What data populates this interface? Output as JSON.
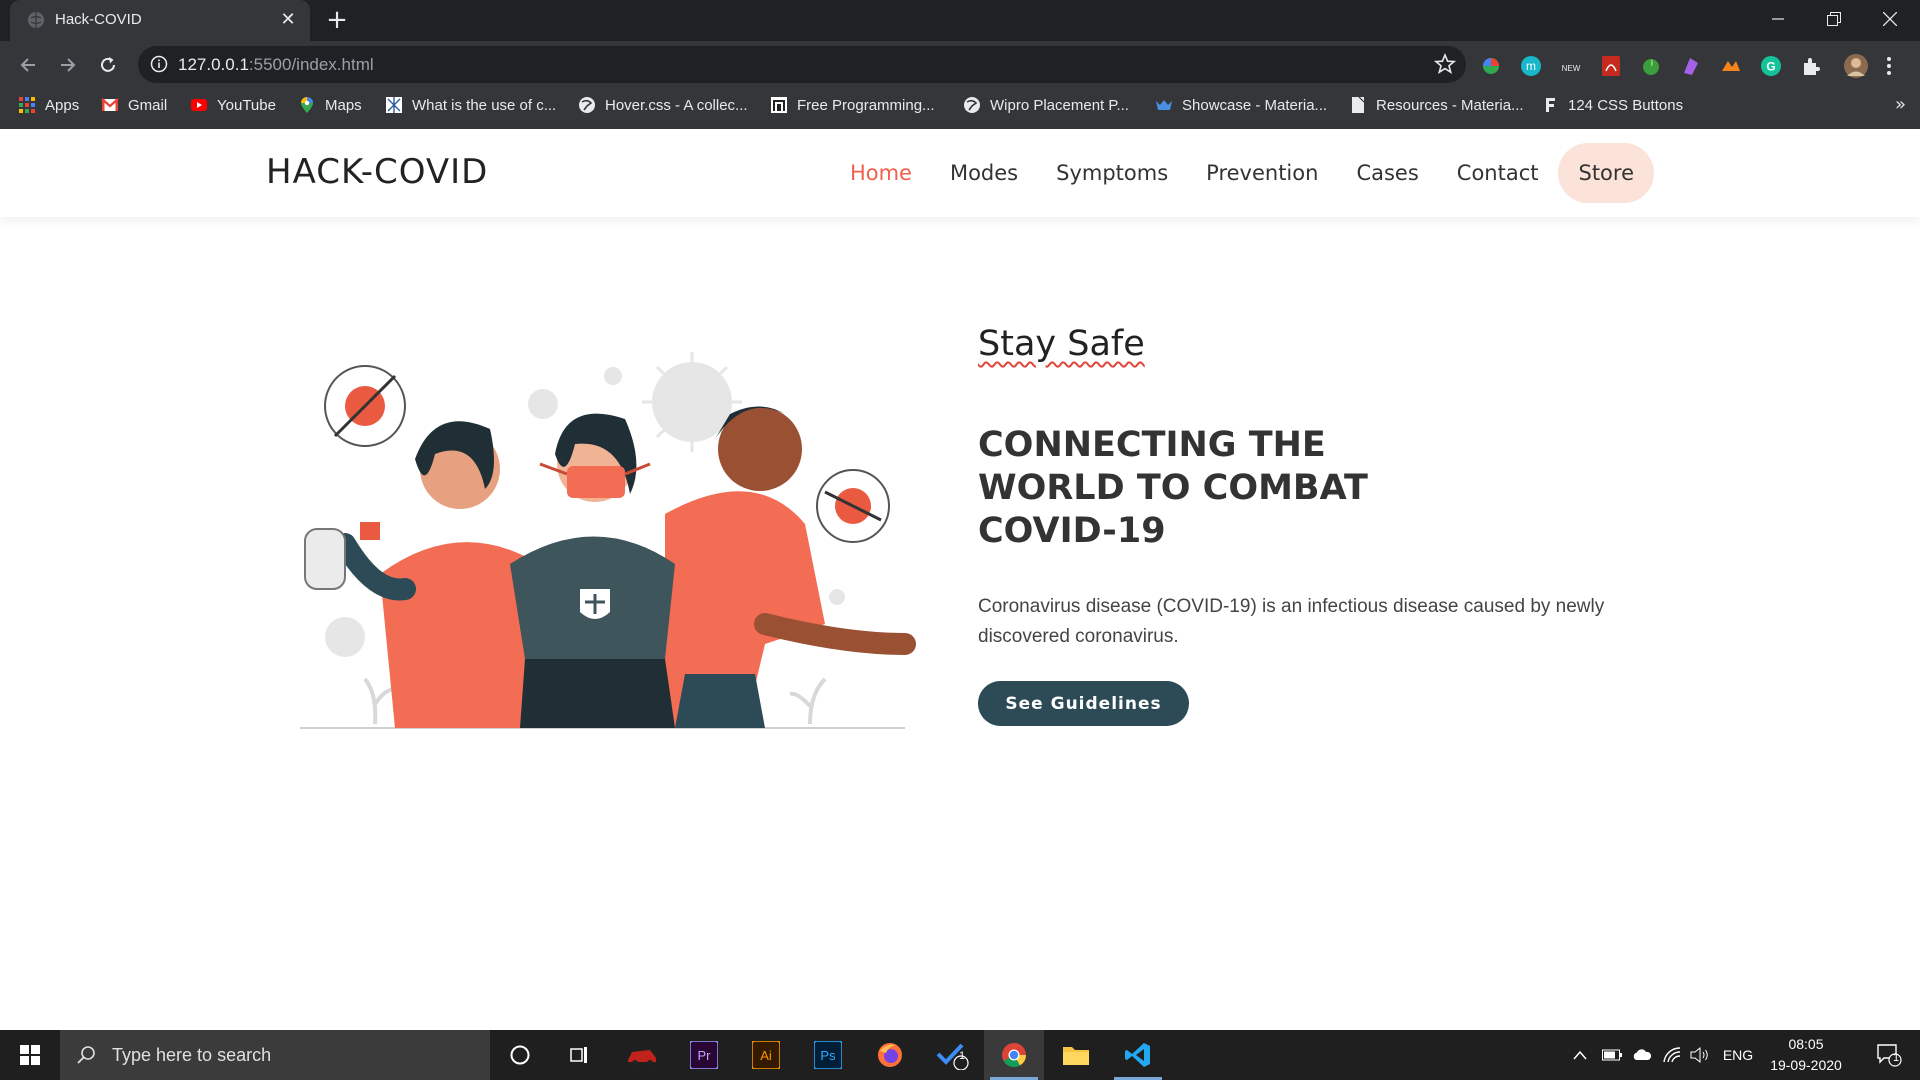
{
  "browser": {
    "tab_title": "Hack-COVID",
    "url_host": "127.0.0.1",
    "url_rest": ":5500/index.html",
    "bookmarks": [
      {
        "label": "Apps"
      },
      {
        "label": "Gmail"
      },
      {
        "label": "YouTube"
      },
      {
        "label": "Maps"
      },
      {
        "label": "What is the use of c..."
      },
      {
        "label": "Hover.css - A collec..."
      },
      {
        "label": "Free Programming..."
      },
      {
        "label": "Wipro Placement P..."
      },
      {
        "label": "Showcase - Materia..."
      },
      {
        "label": "Resources - Materia..."
      },
      {
        "label": "124 CSS Buttons"
      }
    ],
    "bookmarks_more": "»"
  },
  "site": {
    "logo": "HACK-COVID",
    "nav": [
      {
        "label": "Home",
        "active": true
      },
      {
        "label": "Modes"
      },
      {
        "label": "Symptoms"
      },
      {
        "label": "Prevention"
      },
      {
        "label": "Cases"
      },
      {
        "label": "Contact"
      },
      {
        "label": "Store"
      }
    ]
  },
  "hero": {
    "eyebrow": "Stay Safe",
    "headline": "CONNECTING THE WORLD TO COMBAT COVID-19",
    "description": "Coronavirus disease (COVID-19) is an infectious disease caused by newly discovered coronavirus.",
    "cta_label": "See Guidelines"
  },
  "taskbar": {
    "search_placeholder": "Type here to search",
    "language": "ENG",
    "time": "08:05",
    "date": "19-09-2020",
    "todo_badge": "1",
    "notification_badge": "1"
  },
  "colors": {
    "accent": "#f0604d",
    "store_pill": "#fbe3da",
    "cta": "#2c4b56"
  }
}
